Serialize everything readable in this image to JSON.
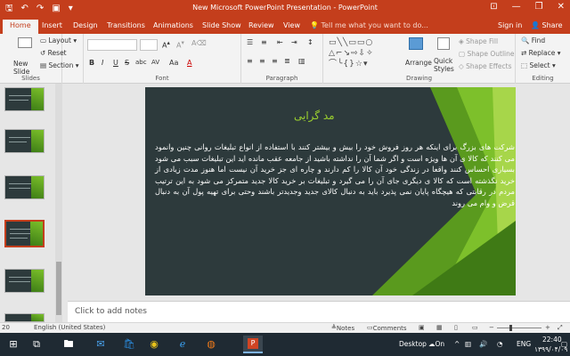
{
  "window": {
    "title": "New Microsoft PowerPoint Presentation - PowerPoint",
    "minimize": "—",
    "restore": "❐",
    "close": "✕"
  },
  "qat": {
    "save": "🖫",
    "undo": "↶",
    "redo": "↷",
    "present": "▣",
    "more": "▾"
  },
  "tabs": [
    "Home",
    "Insert",
    "Design",
    "Transitions",
    "Animations",
    "Slide Show",
    "Review",
    "View"
  ],
  "tellme": "Tell me what you want to do...",
  "signin": "Sign in",
  "share": "Share",
  "ribbon": {
    "slides": {
      "new_slide": "New Slide",
      "layout": "Layout",
      "reset": "Reset",
      "section": "Section",
      "label": "Slides"
    },
    "font": {
      "bold": "B",
      "italic": "I",
      "underline": "U",
      "strike": "S",
      "shadow": "abc",
      "spacing": "AV",
      "case": "Aa",
      "color": "A",
      "label": "Font"
    },
    "paragraph": {
      "label": "Paragraph"
    },
    "drawing": {
      "arrange": "Arrange",
      "quick_styles": "Quick Styles",
      "shape_fill": "Shape Fill",
      "shape_outline": "Shape Outline",
      "shape_effects": "Shape Effects",
      "label": "Drawing"
    },
    "editing": {
      "find": "Find",
      "replace": "Replace",
      "select": "Select",
      "label": "Editing"
    }
  },
  "slide": {
    "title": "مد گرایی",
    "body": "شرکت های بزرگ برای اینکه هر روز فروش خود را بیش و بیشتر کنند با استفاده از انواع تبلیغات روانی چنین وانمود می کنند که کالا ی آن ها ویژه است و اگر شما آن را نداشته باشید از جامعه عقب مانده اید این تبلیغات سبب می شود بسیاری احساس کنند واقعا در زندگی خود آن کالا را کم دارند و چاره ای جز خرید آن نیست  اما هنوز مدت زیادی از خرید نگذشته است که کالا ی دیگری جای آن را می گیرد و تبلیغات بر خرید کالا جدید متمرکز می شود به این ترتیب مردم در رقابتی که هیچگاه پایان نمی پذیرد باید به دنبال کالای جدید وجدیدتر باشند وحتی برای تهیه پول آن به دنبال قرض و وام می روند"
  },
  "notes_placeholder": "Click to add notes",
  "status": {
    "slide_num": "20",
    "language": "English (United States)",
    "notes": "Notes",
    "comments": "Comments"
  },
  "tray": {
    "desktop": "Desktop",
    "on": "On",
    "lang": "ENG",
    "time": "22:40",
    "date": "۱۳۹۹/۰۴/۰۹"
  }
}
